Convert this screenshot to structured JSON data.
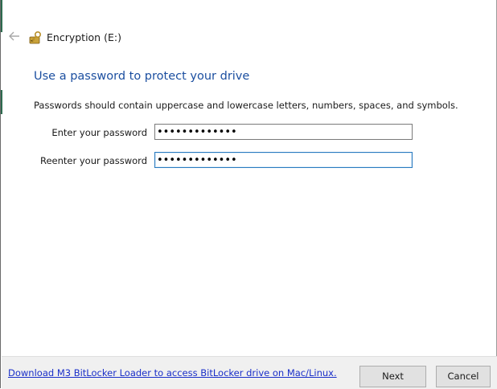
{
  "window": {
    "title": "Encryption (E:)"
  },
  "icons": {
    "back": "back-arrow-icon",
    "drive": "bitlocker-drive-icon"
  },
  "main": {
    "heading": "Use a password to protect your drive",
    "description": "Passwords should contain uppercase and lowercase letters, numbers, spaces, and symbols.",
    "password_label": "Enter your password",
    "password_value": "•••••••••••••",
    "reenter_label": "Reenter your password",
    "reenter_value": "•••••••••••••"
  },
  "footer": {
    "link_text": "Download M3 BitLocker Loader to access BitLocker drive on Mac/Linux.",
    "next_label": "Next",
    "cancel_label": "Cancel"
  },
  "colors": {
    "heading": "#1c4fa0",
    "link": "#1a2fc9",
    "focus_border": "#2b7bc0",
    "footer_bg": "#f0f0f0"
  }
}
